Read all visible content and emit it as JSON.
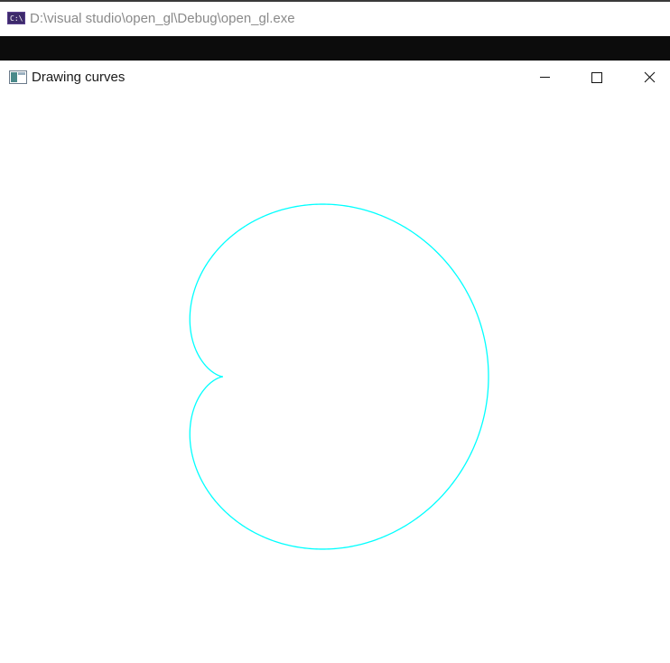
{
  "console_window": {
    "title": "D:\\visual studio\\open_gl\\Debug\\open_gl.exe",
    "icon": "console-app-icon",
    "background_color": "#0c0c0c"
  },
  "gl_window": {
    "title": "Drawing curves",
    "icon": "opengl-window-icon",
    "buttons": {
      "minimize": "minimize-icon",
      "maximize": "maximize-icon",
      "close": "close-icon"
    },
    "canvas_background": "#ffffff",
    "curve_color": "#00ffff",
    "curve_shape": "cardioid"
  }
}
